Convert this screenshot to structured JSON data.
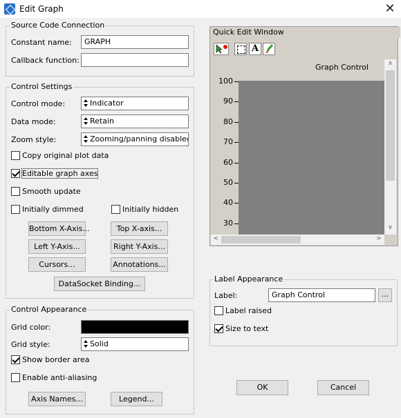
{
  "window": {
    "title": "Edit Graph",
    "close_glyph": "✕"
  },
  "source_code": {
    "legend": "Source Code Connection",
    "constant_name_label": "Constant name:",
    "constant_name_value": "GRAPH",
    "callback_label": "Callback function:",
    "callback_value": ""
  },
  "control_settings": {
    "legend": "Control Settings",
    "control_mode_label": "Control mode:",
    "control_mode_value": "Indicator",
    "data_mode_label": "Data mode:",
    "data_mode_value": "Retain",
    "zoom_style_label": "Zoom style:",
    "zoom_style_value": "Zooming/panning disabled",
    "copy_original_label": "Copy original plot data",
    "copy_original_checked": false,
    "editable_axes_label": "Editable graph axes",
    "editable_axes_checked": true,
    "smooth_update_label": "Smooth update",
    "smooth_update_checked": false,
    "initially_dimmed_label": "Initially dimmed",
    "initially_dimmed_checked": false,
    "initially_hidden_label": "Initially hidden",
    "initially_hidden_checked": false,
    "bottom_x_axis": "Bottom X-Axis...",
    "top_x_axis": "Top X-axis...",
    "left_y_axis": "Left Y-Axis...",
    "right_y_axis": "Right Y-Axis...",
    "cursors": "Cursors...",
    "annotations": "Annotations...",
    "datasocket": "DataSocket Binding..."
  },
  "control_appearance": {
    "legend": "Control Appearance",
    "grid_color_label": "Grid color:",
    "grid_color": "#000000",
    "grid_style_label": "Grid style:",
    "grid_style_value": "Solid",
    "show_border_label": "Show border area",
    "show_border_checked": true,
    "anti_aliasing_label": "Enable anti-aliasing",
    "anti_aliasing_checked": false,
    "axis_names": "Axis Names...",
    "legend_button": "Legend..."
  },
  "quick_edit": {
    "title": "Quick Edit Window",
    "graph_label": "Graph Control",
    "plot_color": "#808080",
    "y_ticks": [
      "100",
      "90",
      "80",
      "70",
      "60",
      "50",
      "40",
      "30"
    ],
    "tools": [
      "pointer-color-icon",
      "selection-rect-icon",
      "text-tool-icon",
      "paintbrush-icon"
    ],
    "text_tool_glyph": "A"
  },
  "label_appearance": {
    "legend": "Label Appearance",
    "label_label": "Label:",
    "label_value": "Graph Control",
    "browse_button": "...",
    "label_raised_label": "Label raised",
    "label_raised_checked": false,
    "size_to_text_label": "Size to text",
    "size_to_text_checked": true
  },
  "dialog_buttons": {
    "ok": "OK",
    "cancel": "Cancel"
  }
}
